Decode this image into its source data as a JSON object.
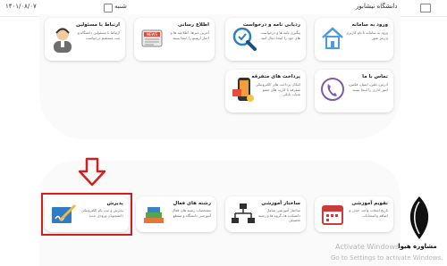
{
  "topbar": {
    "date": "۱۴۰۱/۰۸/۰۷",
    "user_label": "شنبه",
    "university": "دانشگاه نیشابور"
  },
  "cards_row1": [
    {
      "title": "ارتباط با مسئولین",
      "desc": "ارتباط با مسئولین دانشگاه و ثبت مستقیم درخواست",
      "icon": "support-agent-icon"
    },
    {
      "title": "اطلاع رسانی",
      "desc": "آخرین خبرها، اطلاعیه ها و اخبار آرشیو را اینجا ببینید",
      "icon": "news-icon"
    },
    {
      "title": "ردیابی نامه و درخواست",
      "desc": "پیگیری نامه ها و درخواست های خود را اینجا دنبال کنید",
      "icon": "search-tracking-icon"
    },
    {
      "title": "ورود به سامانه",
      "desc": "ورود به سامانه با نام کاربری و رمز عبور",
      "icon": "home-login-icon"
    }
  ],
  "cards_row2": [
    {
      "title": "پرداخت های متفرقه",
      "desc": "امکان پرداخت های الکترونیکی متفرقه با کارت های عضو شتاب بانکی",
      "icon": "mobile-payment-icon"
    },
    {
      "title": "تماس با ما",
      "desc": "آدرس، تلفن، ایمیل، فکس، امور اداری را اینجا ببینید",
      "icon": "phone-contact-icon"
    }
  ],
  "cards_row3": [
    {
      "title": "پذیرش",
      "desc": "پذیرش و ثبت نام الکترونیکی دانشجویان ورودی جدید",
      "icon": "signature-form-icon"
    },
    {
      "title": "رشته های فعال",
      "desc": "مشخصات رشته های فعال آموزشی دانشگاه و مقطع",
      "icon": "books-icon"
    },
    {
      "title": "ساختار آموزشی",
      "desc": "ساختار آموزشی شامل دانشکده ها، گروه ها و رشته تحصیلی",
      "icon": "org-chart-icon"
    },
    {
      "title": "تقویم آموزشی",
      "desc": "تاریخ انتخاب واحد، حذف و اضافه و امتحانات",
      "icon": "calendar-icon"
    }
  ],
  "watermark": {
    "line1": "Activate Windows",
    "line2": "Go to Settings to activate Windows."
  },
  "brand": {
    "name": "مشاوره هیوا"
  },
  "colors": {
    "highlight": "#d01f1f",
    "arrow": "#d01f1f",
    "topbar_bg": "#ffffff"
  }
}
